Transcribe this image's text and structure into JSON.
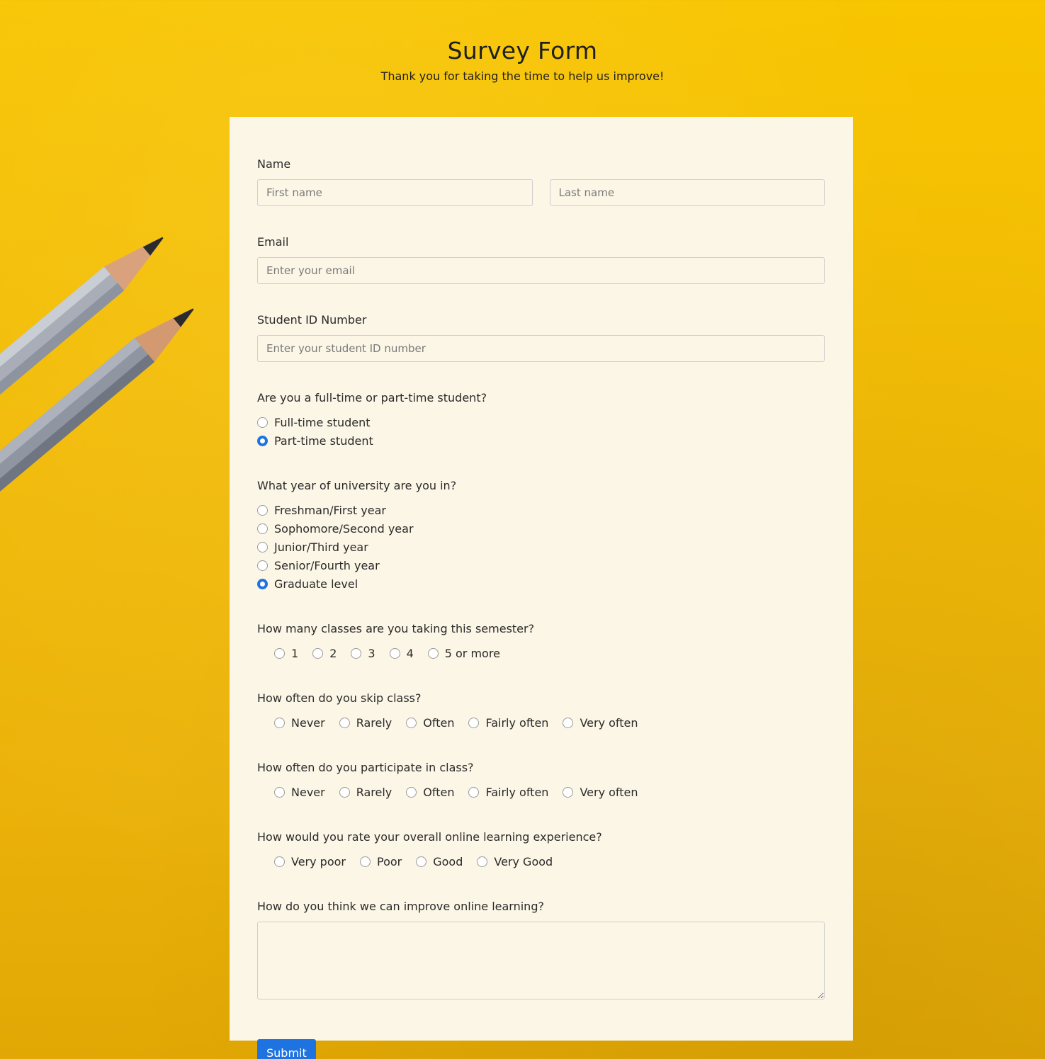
{
  "header": {
    "title": "Survey Form",
    "subtitle": "Thank you for taking the time to help us improve!"
  },
  "colors": {
    "background": "#f5c000",
    "card": "#fbf6e6",
    "accent": "#1e73e0"
  },
  "form": {
    "name": {
      "label": "Name",
      "first_placeholder": "First name",
      "last_placeholder": "Last name"
    },
    "email": {
      "label": "Email",
      "placeholder": "Enter your email"
    },
    "student_id": {
      "label": "Student ID Number",
      "placeholder": "Enter your student ID number"
    },
    "status": {
      "question": "Are you a full-time or part-time student?",
      "options": [
        "Full-time student",
        "Part-time student"
      ],
      "selected": "Part-time student"
    },
    "year": {
      "question": "What year of university are you in?",
      "options": [
        "Freshman/First year",
        "Sophomore/Second year",
        "Junior/Third year",
        "Senior/Fourth year",
        "Graduate level"
      ],
      "selected": "Graduate level"
    },
    "classes": {
      "question": "How many classes are you taking this semester?",
      "options": [
        "1",
        "2",
        "3",
        "4",
        "5 or more"
      ]
    },
    "skip": {
      "question": "How often do you skip class?",
      "options": [
        "Never",
        "Rarely",
        "Often",
        "Fairly often",
        "Very often"
      ]
    },
    "participate": {
      "question": "How often do you participate in class?",
      "options": [
        "Never",
        "Rarely",
        "Often",
        "Fairly often",
        "Very often"
      ]
    },
    "rating": {
      "question": "How would you rate your overall online learning experience?",
      "options": [
        "Very poor",
        "Poor",
        "Good",
        "Very Good"
      ]
    },
    "improve": {
      "question": "How do you think we can improve online learning?",
      "value": ""
    },
    "submit_label": "Submit"
  }
}
